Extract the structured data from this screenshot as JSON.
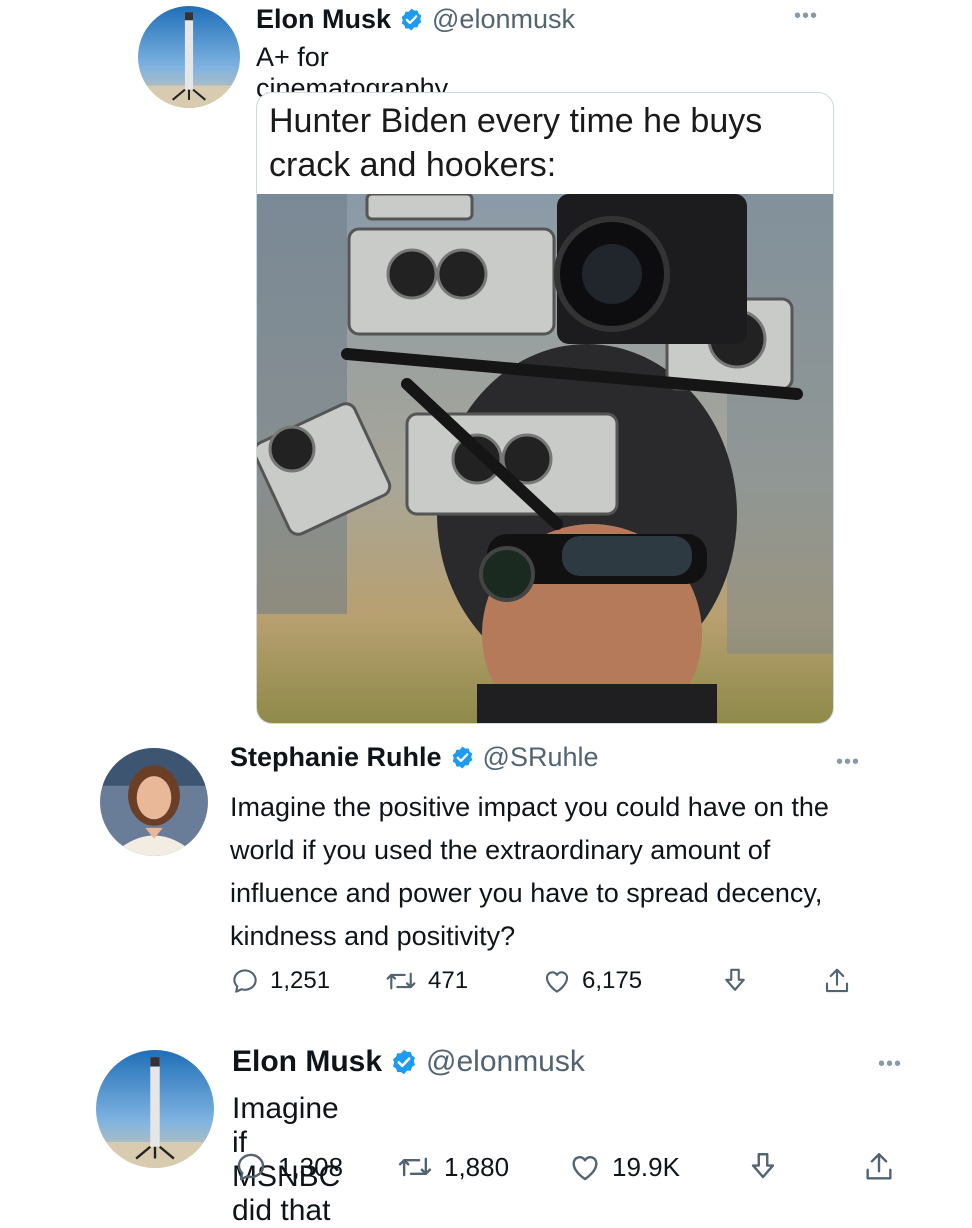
{
  "tweets": [
    {
      "author": "Elon Musk",
      "handle": "@elonmusk",
      "text": "A+ for cinematography",
      "more": "•••",
      "meme_caption": "Hunter Biden every time he buys crack and hookers:"
    },
    {
      "author": "Stephanie Ruhle",
      "handle": "@SRuhle",
      "text": "Imagine the positive impact you could have on the world if you used the extraordinary amount of influence and power you have to spread decency, kindness and positivity?",
      "more": "•••",
      "replies": "1,251",
      "retweets": "471",
      "likes": "6,175"
    },
    {
      "author": "Elon Musk",
      "handle": "@elonmusk",
      "text": "Imagine if MSNBC did that",
      "more": "•••",
      "replies": "1,308",
      "retweets": "1,880",
      "likes": "19.9K"
    }
  ],
  "colors": {
    "verified": "#1d9bf0",
    "secondary_text": "#536471",
    "primary_text": "#0f1419"
  },
  "icons": [
    "verified-badge-icon",
    "more-icon",
    "reply-icon",
    "retweet-icon",
    "like-icon",
    "bookmark-icon",
    "share-icon"
  ]
}
